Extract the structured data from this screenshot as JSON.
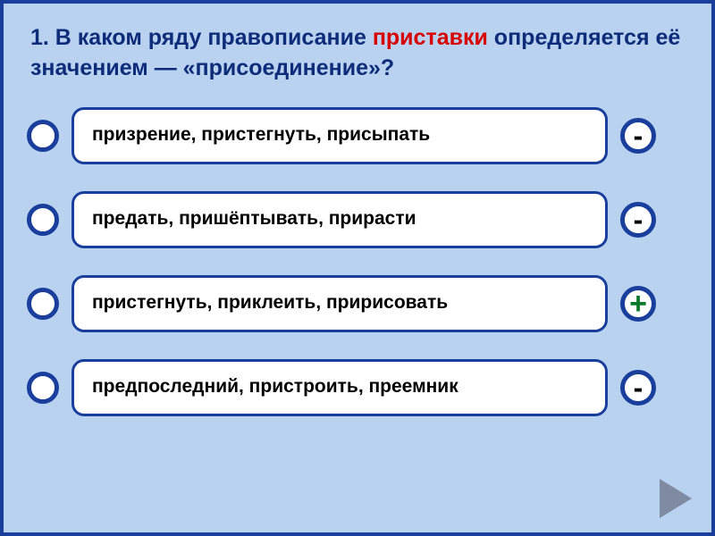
{
  "question": {
    "prefix": "1. В каком ряду правописание ",
    "highlight": "приставки",
    "middle": " определяется её значением — ",
    "quoted": "«присоединение»?"
  },
  "options": [
    {
      "text": "призрение, пристегнуть, присыпать",
      "mark": "-"
    },
    {
      "text": "предать, пришёптывать, прирасти",
      "mark": "-"
    },
    {
      "text": "пристегнуть, приклеить, пририсовать",
      "mark": "+"
    },
    {
      "text": "предпоследний, пристроить, преемник",
      "mark": "-"
    }
  ]
}
